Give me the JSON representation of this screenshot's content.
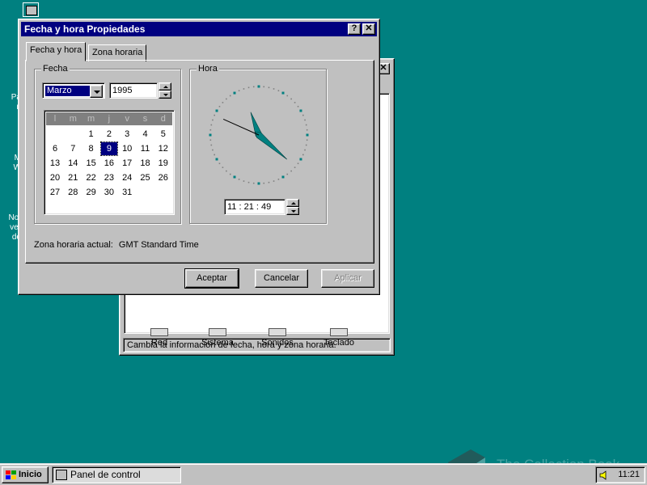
{
  "desktop": {
    "icons": [
      {
        "label": "Pa\nn"
      },
      {
        "label": "M\nW"
      },
      {
        "label": "Not\nver\nde"
      }
    ]
  },
  "control_panel": {
    "items": [
      {
        "label": "Red"
      },
      {
        "label": "Sistema"
      },
      {
        "label": "Sonidos"
      },
      {
        "label": "Teclado"
      }
    ],
    "status": "Cambia la información de fecha, hora y zona horaria."
  },
  "dialog": {
    "title": "Fecha y hora Propiedades",
    "help_button": "?",
    "close_button": "✕",
    "tabs": [
      {
        "label": "Fecha y hora",
        "active": true
      },
      {
        "label": "Zona horaria",
        "active": false
      }
    ],
    "date_group": {
      "legend": "Fecha",
      "month": "Marzo",
      "year": "1995",
      "weekdays": [
        "l",
        "m",
        "m",
        "j",
        "v",
        "s",
        "d"
      ],
      "weeks": [
        [
          "",
          "",
          "1",
          "2",
          "3",
          "4",
          "5"
        ],
        [
          "6",
          "7",
          "8",
          "9",
          "10",
          "11",
          "12"
        ],
        [
          "13",
          "14",
          "15",
          "16",
          "17",
          "18",
          "19"
        ],
        [
          "20",
          "21",
          "22",
          "23",
          "24",
          "25",
          "26"
        ],
        [
          "27",
          "28",
          "29",
          "30",
          "31",
          "",
          ""
        ]
      ],
      "selected_day": "9"
    },
    "time_group": {
      "legend": "Hora",
      "time": "11 : 21 : 49",
      "hour": 11,
      "minute": 21,
      "second": 49,
      "hand_color": "#008080"
    },
    "timezone_label": "Zona horaria actual:",
    "timezone_value": "GMT Standard Time",
    "buttons": {
      "ok": "Aceptar",
      "cancel": "Cancelar",
      "apply": "Aplicar"
    }
  },
  "taskbar": {
    "start_label": "Inicio",
    "task_label": "Panel de control",
    "clock": "11:21"
  },
  "watermark": "The Collection Book",
  "colors": {
    "desktop": "#008080",
    "title_bar": "#000080",
    "face": "#c0c0c0"
  }
}
